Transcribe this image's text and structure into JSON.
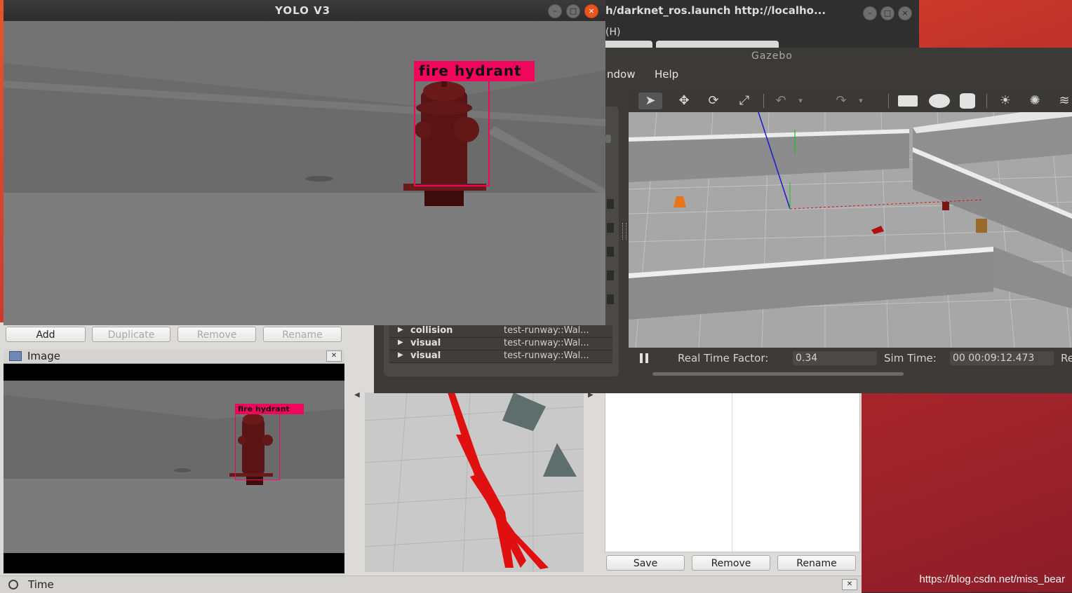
{
  "desktop": {
    "watermark": "https://blog.csdn.net/miss_bear"
  },
  "terminal": {
    "title": "h/darknet_ros.launch http://localho...",
    "menu_label": "(H)"
  },
  "yolo_window": {
    "title": "YOLO V3",
    "detection_label": "fire hydrant"
  },
  "gazebo": {
    "title": "Gazebo",
    "menu": [
      "ndow",
      "Help"
    ],
    "tree_rows": [
      {
        "key": "collision",
        "value": "test-runway::Wal..."
      },
      {
        "key": "visual",
        "value": "test-runway::Wal..."
      },
      {
        "key": "visual",
        "value": "test-runway::Wal..."
      }
    ],
    "status": {
      "rtf_label": "Real Time Factor:",
      "rtf_value": "0.34",
      "sim_label": "Sim Time:",
      "sim_value": "00 00:09:12.473",
      "trailing_label": "Re"
    },
    "toolbar_icons": [
      "select-arrow-icon",
      "translate-icon",
      "rotate-icon",
      "scale-icon",
      "undo-icon",
      "redo-icon",
      "box-icon",
      "sphere-icon",
      "cylinder-icon",
      "sun-light-icon",
      "spot-light-icon",
      "directional-light-icon"
    ]
  },
  "rviz": {
    "display_buttons": {
      "add": "Add",
      "duplicate": "Duplicate",
      "remove": "Remove",
      "rename": "Rename"
    },
    "image_panel": {
      "title": "Image",
      "detection_label": "fire hydrant"
    },
    "right_buttons": {
      "save": "Save",
      "remove": "Remove",
      "rename": "Rename"
    },
    "time_panel": {
      "title": "Time"
    }
  }
}
